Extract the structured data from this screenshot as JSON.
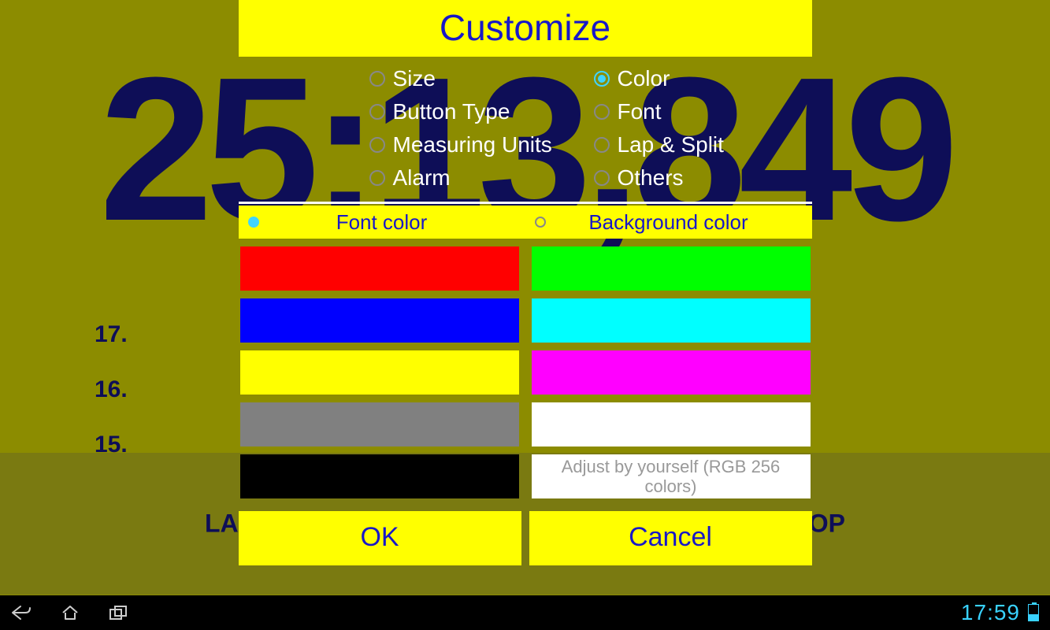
{
  "background": {
    "timer": "25:13,849",
    "laps": [
      {
        "index": "17."
      },
      {
        "index": "16."
      },
      {
        "index": "15."
      }
    ],
    "lap_btn": "LAP/SPLIT",
    "stop_btn": "STOP"
  },
  "navbar": {
    "clock": "17:59"
  },
  "dialog": {
    "title": "Customize",
    "categories": [
      {
        "label": "Size",
        "selected": false
      },
      {
        "label": "Color",
        "selected": true
      },
      {
        "label": "Button Type",
        "selected": false
      },
      {
        "label": "Font",
        "selected": false
      },
      {
        "label": "Measuring Units",
        "selected": false
      },
      {
        "label": "Lap & Split",
        "selected": false
      },
      {
        "label": "Alarm",
        "selected": false
      },
      {
        "label": "Others",
        "selected": false
      }
    ],
    "tabs": {
      "font_color": "Font color",
      "bg_color": "Background color",
      "selected": "font_color"
    },
    "custom_label": "Adjust by yourself (RGB 256 colors)",
    "colors_left": [
      "#ff0000",
      "#0000ff",
      "#ffff00",
      "#808080",
      "#000000"
    ],
    "colors_right": [
      "#00ff00",
      "#00ffff",
      "#ff00ff",
      "#ffffff"
    ],
    "ok": "OK",
    "cancel": "Cancel"
  }
}
